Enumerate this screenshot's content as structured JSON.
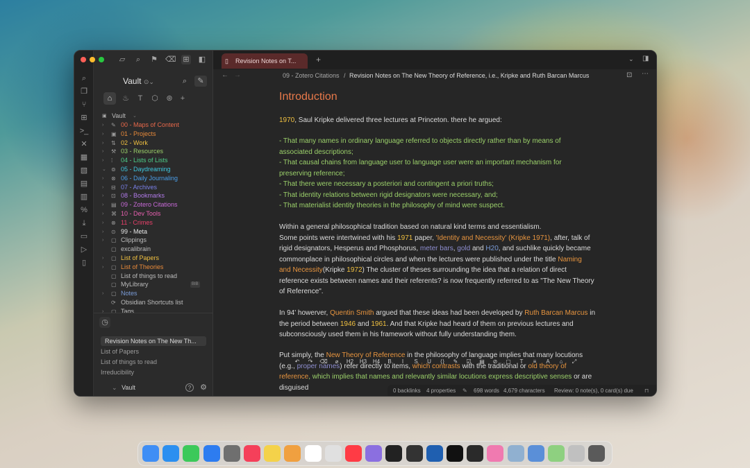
{
  "window": {
    "vault_title": "Vault",
    "vault_title_suffix": "⌄",
    "tab_label": "Revision Notes on T...",
    "breadcrumb": {
      "parent": "09 - Zotero Citations",
      "sep": "/",
      "current": "Revision Notes on The New Theory of Reference, i.e., Kripke and Ruth Barcan Marcus"
    }
  },
  "tree": {
    "root_label": "Vault",
    "items": [
      {
        "label": "00 - Maps of Content",
        "color": "#e8684a",
        "icon": "✎",
        "chev": "›"
      },
      {
        "label": "01 - Projects",
        "color": "#e88a3a",
        "icon": "▣",
        "chev": "›"
      },
      {
        "label": "02 - Work",
        "color": "#f0c040",
        "icon": "⇅",
        "chev": "›"
      },
      {
        "label": "03 - Resources",
        "color": "#9bd06a",
        "icon": "⚒",
        "chev": "›"
      },
      {
        "label": "04 - Lists of Lists",
        "color": "#4ed08a",
        "icon": "⁞",
        "chev": "›"
      },
      {
        "label": "05 - Daydreaming",
        "color": "#3fc8e0",
        "icon": "⊚",
        "chev": "⌄"
      },
      {
        "label": "06 - Daily Journaling",
        "color": "#4a9ee8",
        "icon": "⊗",
        "chev": "›"
      },
      {
        "label": "07 - Archives",
        "color": "#7a80e8",
        "icon": "⊟",
        "chev": "›"
      },
      {
        "label": "08 - Bookmarks",
        "color": "#b07ae8",
        "icon": "⊡",
        "chev": "›"
      },
      {
        "label": "09 - Zotero Citations",
        "color": "#c86ad8",
        "icon": "▤",
        "chev": "›"
      },
      {
        "label": "10 - Dev Tools",
        "color": "#e860b0",
        "icon": "⌘",
        "chev": "›"
      },
      {
        "label": "11 - Crimes",
        "color": "#e8406a",
        "icon": "⊗",
        "chev": "›"
      },
      {
        "label": "99 - Meta",
        "color": "#e6e6e6",
        "icon": "⊙",
        "chev": "›"
      },
      {
        "label": "Clippings",
        "color": "#bdbdbd",
        "icon": "▢",
        "chev": "›"
      },
      {
        "label": "excalibrain",
        "color": "#bdbdbd",
        "icon": "▢",
        "chev": ""
      },
      {
        "label": "List of Papers",
        "color": "#f0c040",
        "icon": "▢",
        "chev": "›"
      },
      {
        "label": "List of Theories",
        "color": "#e88a3a",
        "icon": "▢",
        "chev": "›"
      },
      {
        "label": "List of things to read",
        "color": "#bdbdbd",
        "icon": "▢",
        "chev": ""
      },
      {
        "label": "MyLibrary",
        "color": "#bdbdbd",
        "icon": "▢",
        "chev": "",
        "badge": "BIB"
      },
      {
        "label": "Notes",
        "color": "#7a9cd8",
        "icon": "▢",
        "chev": "›"
      },
      {
        "label": "Obsidian Shortcuts list",
        "color": "#bdbdbd",
        "icon": "⟳",
        "chev": ""
      },
      {
        "label": "Tags",
        "color": "#bdbdbd",
        "icon": "▢",
        "chev": "›"
      }
    ]
  },
  "recent": {
    "items": [
      "Revision Notes on The New Th...",
      "List of Papers",
      "List of things to read",
      "Irreducibility"
    ]
  },
  "bottom": {
    "vault_label": "Vault"
  },
  "note": {
    "heading": "Introduction",
    "p1_year": "1970",
    "p1_text": ", Saul Kripke delivered three lectures at Princeton. there he argued:",
    "list": [
      "- That many names in ordinary language referred to objects directly rather than by means of associated descriptions;",
      "- That causal chains from language user to language user were an important mechanism for preserving reference;",
      "- That there were necessary a posteriori and contingent a priori truths;",
      "- That identity relations between rigid designators were necessary, and;",
      "- That materialist identity theories in the philosophy of mind were suspect."
    ],
    "p2_a": "Within a general philosophical tradition based on natural kind terms and essentialism.",
    "p2_b": "Some points were intertwined with his ",
    "p2_year": "1971",
    "p2_c": " paper, ",
    "p2_link1": "'Identity and Necessity' (Kripke 1971)",
    "p2_d": ", after, talk of rigid designators, Hesperus and Phosphorus, ",
    "p2_link2": "meter bars",
    "p2_e": ", ",
    "p2_link3": "gold",
    "p2_f": " and ",
    "p2_link4": "H20",
    "p2_g": ", and suchlike quickly became commonplace in philosophical circles and when the lectures were published under the title ",
    "p2_link5": "Naming and Necessity",
    "p2_h": "(Kripke ",
    "p2_year2": "1972",
    "p2_i": ") The cluster of theses surrounding the idea that a relation of direct reference exists between names and their referents? is now frequently referred to as \"The New Theory of Reference\".",
    "p3_a": "In 94' howerver, ",
    "p3_link1": "Quentin Smith",
    "p3_b": " argued that these ideas had been developed by ",
    "p3_link2": "Ruth Barcan Marcus",
    "p3_c": " in the period between ",
    "p3_year1": "1946",
    "p3_d": " and ",
    "p3_year2": "1961",
    "p3_e": ". And that Kripke had heard of them on previous lectures and subconsciously used them in his framework without fully understanding them.",
    "p4_a": "Put simply, the ",
    "p4_link1": "New Theory of Reference",
    "p4_b": " in the philosophy of language implies that many locutions (e.g., ",
    "p4_link2": "proper names",
    "p4_c": ") refer directly to items, ",
    "p4_link3": "which contrasts",
    "p4_d": " with the traditional or ",
    "p4_link4": "old theory of reference",
    "p4_e": ", which implies that names and relevantly similar locutions express descriptive senses",
    "p4_f": " or are disguised"
  },
  "status": {
    "backlinks": "0 backlinks",
    "properties": "4 properties",
    "words": "698 words",
    "characters": "4,679 characters",
    "review": "Review: 0 note(s), 0 card(s) due"
  },
  "toolbar_items": [
    "↶",
    "↷",
    "⌫",
    "⌀",
    "H2",
    "H3",
    "H4",
    "B",
    "I",
    "S",
    "U",
    "⟨⟩",
    "✎",
    "☑",
    "▤",
    "⊘",
    "▢",
    "T",
    "≡",
    "A",
    "⌂",
    "⤢"
  ]
}
